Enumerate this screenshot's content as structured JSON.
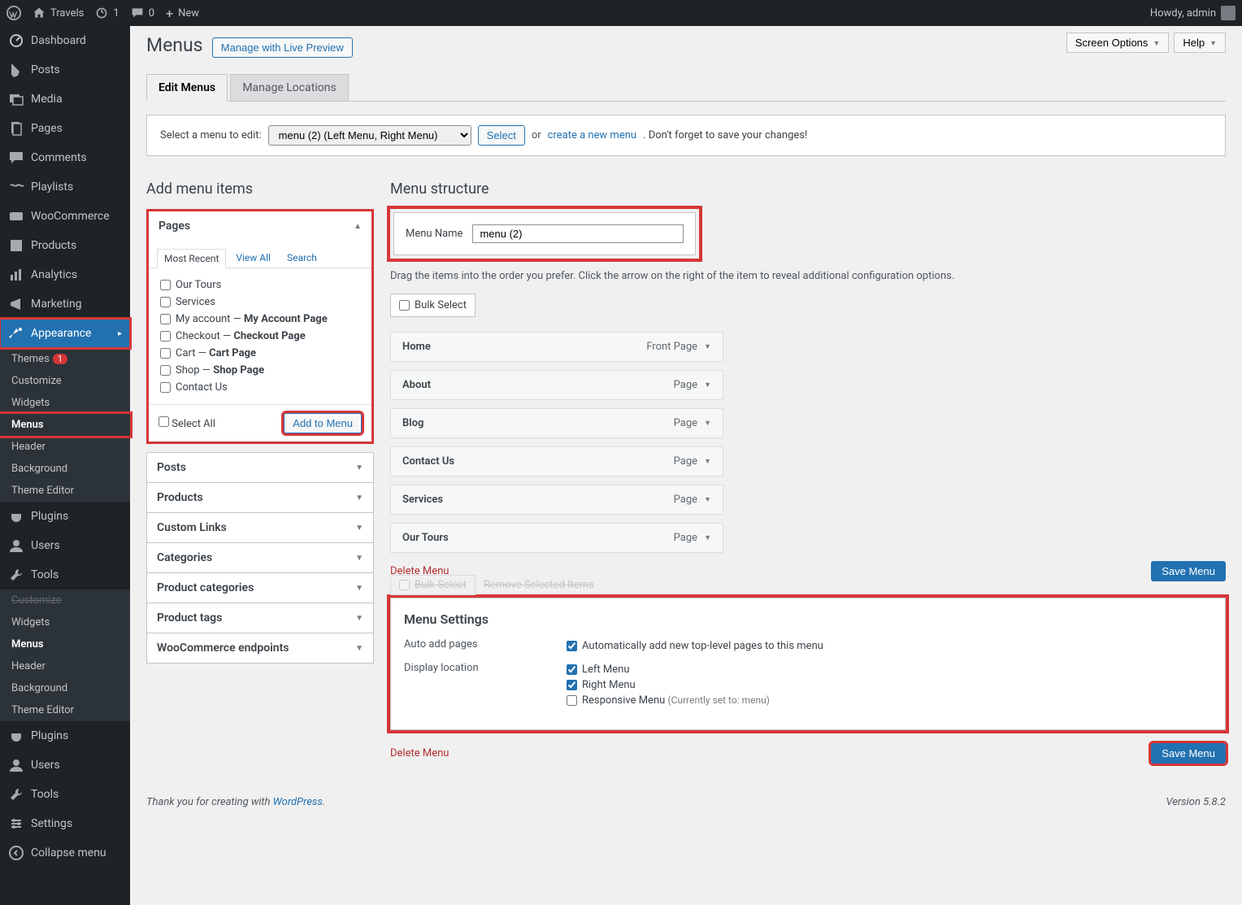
{
  "adminbar": {
    "site": "Travels",
    "updates": "1",
    "comments": "0",
    "new": "New",
    "howdy": "Howdy, admin"
  },
  "sidebar": {
    "dashboard": "Dashboard",
    "posts": "Posts",
    "media": "Media",
    "pages": "Pages",
    "comments": "Comments",
    "playlists": "Playlists",
    "woocommerce": "WooCommerce",
    "products": "Products",
    "analytics": "Analytics",
    "marketing": "Marketing",
    "appearance": "Appearance",
    "appearance_sub": {
      "themes": "Themes",
      "themes_badge": "1",
      "customize": "Customize",
      "widgets": "Widgets",
      "menus": "Menus",
      "header": "Header",
      "background": "Background",
      "theme_editor": "Theme Editor"
    },
    "plugins": "Plugins",
    "users": "Users",
    "tools": "Tools",
    "dup": {
      "customize": "Customize",
      "widgets": "Widgets",
      "menus": "Menus",
      "header": "Header",
      "background": "Background",
      "theme_editor": "Theme Editor",
      "plugins": "Plugins",
      "users": "Users",
      "tools": "Tools",
      "settings": "Settings",
      "collapse": "Collapse menu"
    }
  },
  "top": {
    "screen": "Screen Options",
    "help": "Help"
  },
  "heading": "Menus",
  "manage_preview": "Manage with Live Preview",
  "tabs": {
    "edit": "Edit Menus",
    "locations": "Manage Locations"
  },
  "selectrow": {
    "label": "Select a menu to edit:",
    "option": "menu (2) (Left Menu, Right Menu)",
    "select_btn": "Select",
    "or": "or",
    "create": "create a new menu",
    "rest": ". Don't forget to save your changes!"
  },
  "left": {
    "title": "Add menu items",
    "pages": "Pages",
    "tabs": {
      "recent": "Most Recent",
      "all": "View All",
      "search": "Search"
    },
    "items": [
      "Our Tours",
      "Services",
      "My account — ",
      "My Account Page",
      "Checkout — ",
      "Checkout Page",
      "Cart — ",
      "Cart Page",
      "Shop — ",
      "Shop Page",
      "Contact Us"
    ],
    "select_all": "Select All",
    "add_to_menu": "Add to Menu",
    "panels": [
      "Posts",
      "Products",
      "Custom Links",
      "Categories",
      "Product categories",
      "Product tags",
      "WooCommerce endpoints"
    ]
  },
  "right": {
    "title": "Menu structure",
    "menu_name_lbl": "Menu Name",
    "menu_name_val": "menu (2)",
    "instr": "Drag the items into the order you prefer. Click the arrow on the right of the item to reveal additional configuration options.",
    "bulk": "Bulk Select",
    "items": [
      {
        "t": "Home",
        "k": "Front Page"
      },
      {
        "t": "About",
        "k": "Page"
      },
      {
        "t": "Blog",
        "k": "Page"
      },
      {
        "t": "Contact Us",
        "k": "Page"
      },
      {
        "t": "Services",
        "k": "Page"
      },
      {
        "t": "Our Tours",
        "k": "Page"
      }
    ],
    "delete": "Delete Menu",
    "save": "Save Menu",
    "ghost_bulk": "Bulk Select",
    "ghost_remove": "Remove Selected Items",
    "settings": {
      "title": "Menu Settings",
      "auto_lbl": "Auto add pages",
      "auto_opt": "Automatically add new top-level pages to this menu",
      "loc_lbl": "Display location",
      "left": "Left Menu",
      "right_m": "Right Menu",
      "resp": "Responsive Menu",
      "resp_note": "(Currently set to: menu)"
    }
  },
  "footer": {
    "thank": "Thank you for creating with ",
    "wp": "WordPress",
    "dot": ".",
    "version": "Version 5.8.2"
  }
}
